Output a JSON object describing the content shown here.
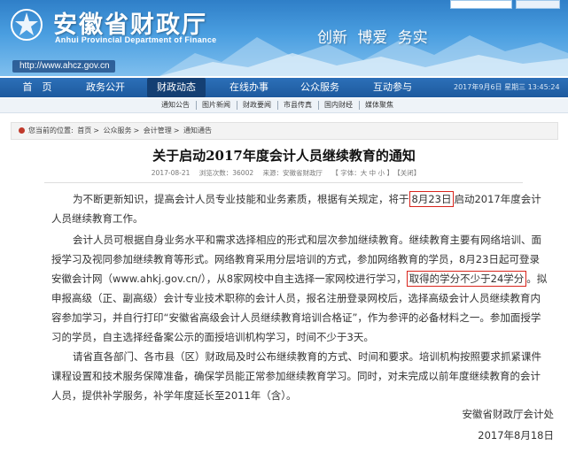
{
  "header": {
    "site_title": "安徽省财政厅",
    "site_subtitle": "Anhui Provincial Department of Finance",
    "slogan": "创新 博爱 务实",
    "url": "http://www.ahcz.gov.cn",
    "colors": {
      "banner": "#3a8ad4",
      "nav": "#1d5a9e",
      "nav_active": "#143f73",
      "highlight_box": "#d8241c"
    }
  },
  "nav": {
    "items": [
      "首　页",
      "政务公开",
      "财政动态",
      "在线办事",
      "公众服务",
      "互动参与"
    ],
    "active_index": 2,
    "datetime": "2017年9月6日 星期三 13:45:24"
  },
  "subnav": {
    "items": [
      "通知公告",
      "图片新闻",
      "财政要闻",
      "市县传真",
      "国内财经",
      "媒体聚焦"
    ]
  },
  "breadcrumb": {
    "prefix": "您当前的位置:",
    "items": [
      "首页",
      "公众服务",
      "会计管理",
      "通知通告"
    ]
  },
  "article": {
    "title": "关于启动2017年度会计人员继续教育的通知",
    "meta": {
      "date": "2017-08-21",
      "views": "浏览次数：36002",
      "source": "来源：安徽省财政厅",
      "font_size": "【 字体：大 中 小 】",
      "close": "【关闭】"
    },
    "p1": {
      "before": "为不断更新知识，提高会计人员专业技能和业务素质，根据有关规定，将于",
      "highlight": "8月23日",
      "after": "启动2017年度会计人员继续教育工作。"
    },
    "p2": {
      "before": "会计人员可根据自身业务水平和需求选择相应的形式和层次参加继续教育。继续教育主要有网络培训、面授学习及视同参加继续教育等形式。网络教育采用分层培训的方式，参加网络教育的学员，8月23日起可登录安徽会计网（www.ahkj.gov.cn/），从8家网校中自主选择一家网校进行学习，",
      "highlight": "取得的学分不少于24学分",
      "after": "。拟申报高级（正、副高级）会计专业技术职称的会计人员，报名注册登录网校后，选择高级会计人员继续教育内容参加学习，并自行打印“安徽省高级会计人员继续教育培训合格证”，作为参评的必备材料之一。参加面授学习的学员，自主选择经备案公示的面授培训机构学习，时间不少于3天。"
    },
    "p3": "请省直各部门、各市县（区）财政局及时公布继续教育的方式、时间和要求。培训机构按照要求抓紧课件课程设置和技术服务保障准备，确保学员能正常参加继续教育学习。同时，对未完成以前年度继续教育的会计人员，提供补学服务，补学年度延长至2011年（含）。",
    "signature_org": "安徽省财政厅会计处",
    "signature_date": "2017年8月18日"
  }
}
